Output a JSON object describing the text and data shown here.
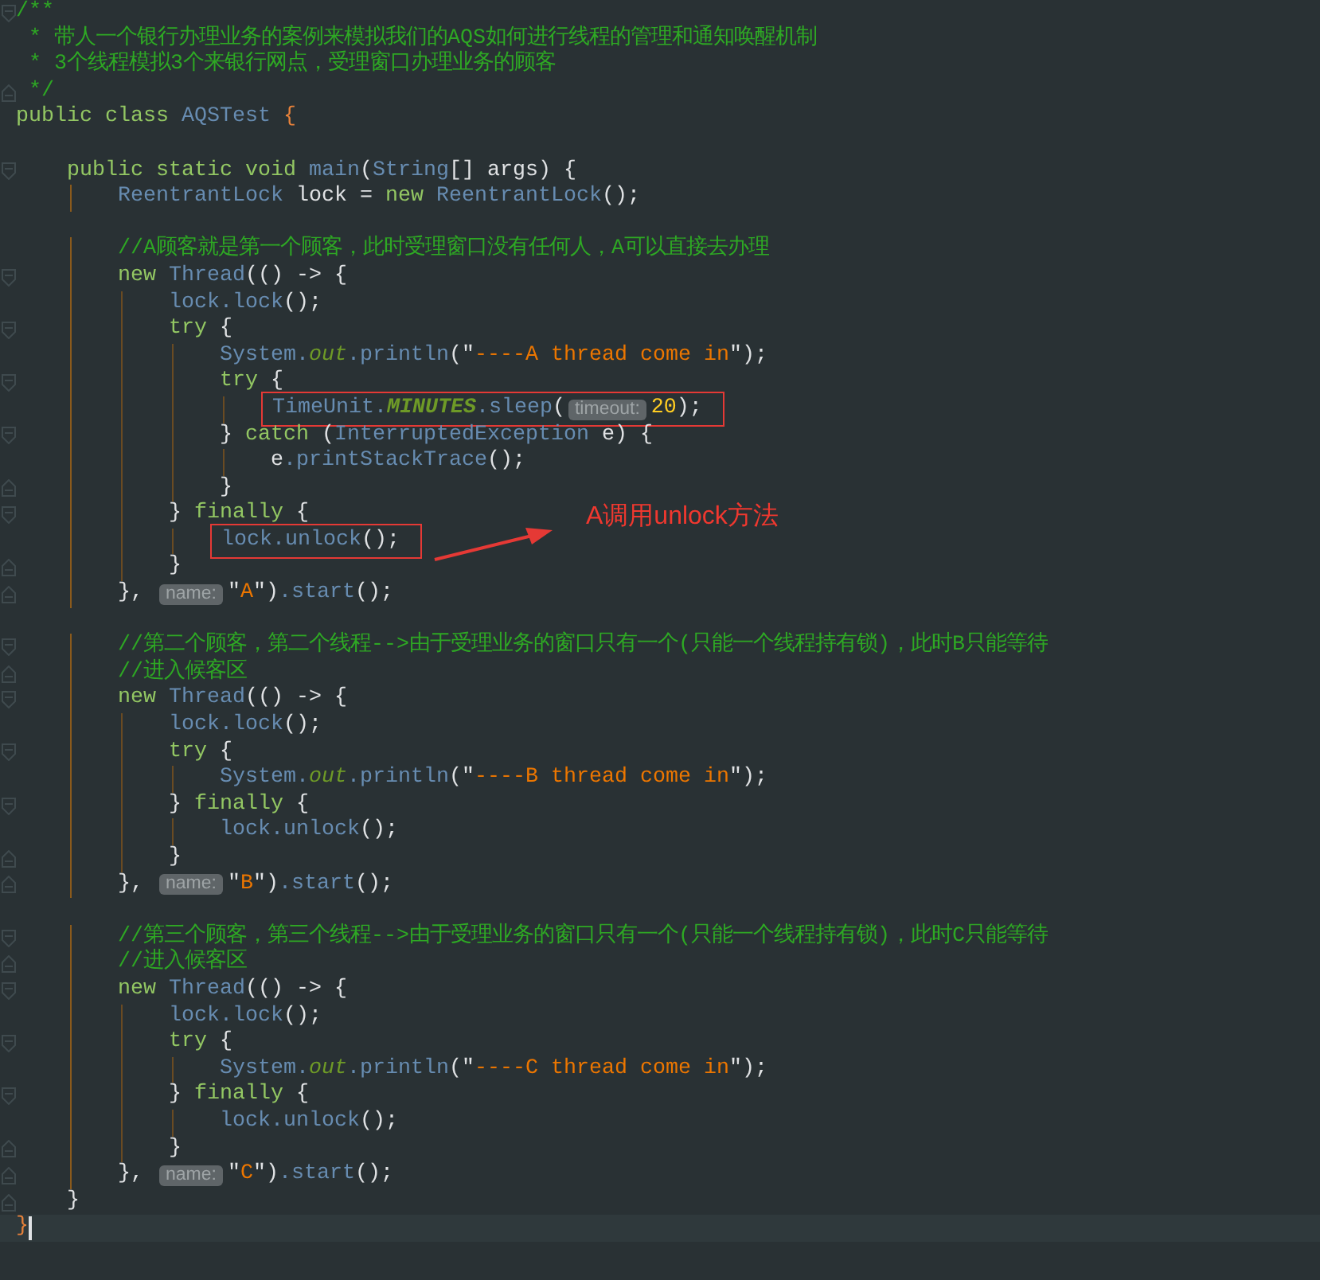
{
  "editor": {
    "lines": [
      {
        "fold_open": true,
        "tokens": [
          {
            "kind": "comment",
            "text": "/**"
          }
        ]
      },
      {
        "tokens": [
          {
            "kind": "comment",
            "text": " * 带人一个银行办理业务的案例来模拟我们的AQS如何进行线程的管理和通知唤醒机制"
          }
        ]
      },
      {
        "tokens": [
          {
            "kind": "comment",
            "text": " * 3个线程模拟3个来银行网点，受理窗口办理业务的顾客"
          }
        ]
      },
      {
        "fold_close": true,
        "tokens": [
          {
            "kind": "comment",
            "text": " */"
          }
        ]
      },
      {
        "tokens": [
          {
            "kind": "keyword",
            "text": "public class "
          },
          {
            "kind": "ident",
            "text": "AQSTest"
          },
          {
            "kind": "accent",
            "text": " {"
          }
        ]
      },
      {
        "blank_before": true,
        "fold_open": true,
        "tokens": [
          {
            "kind": "keyword",
            "text": "    public static void "
          },
          {
            "kind": "ident",
            "text": "main"
          },
          {
            "kind": "plain",
            "text": "("
          },
          {
            "kind": "ident",
            "text": "String"
          },
          {
            "kind": "plain",
            "text": "[] args) {"
          }
        ]
      },
      {
        "tokens": [
          {
            "kind": "ident",
            "text": "        ReentrantLock"
          },
          {
            "kind": "plain",
            "text": " lock = "
          },
          {
            "kind": "keyword",
            "text": "new "
          },
          {
            "kind": "ident",
            "text": "ReentrantLock"
          },
          {
            "kind": "plain",
            "text": "();"
          }
        ]
      },
      {
        "blank_before": true,
        "tokens": [
          {
            "kind": "comment",
            "text": "        //A顾客就是第一个顾客，此时受理窗口没有任何人，A可以直接去办理"
          }
        ]
      },
      {
        "fold_open": true,
        "tokens": [
          {
            "kind": "keyword",
            "text": "        new "
          },
          {
            "kind": "ident",
            "text": "Thread"
          },
          {
            "kind": "plain",
            "text": "(() -> {"
          }
        ]
      },
      {
        "tokens": [
          {
            "kind": "ident",
            "text": "            lock.lock"
          },
          {
            "kind": "plain",
            "text": "();"
          }
        ]
      },
      {
        "fold_open": true,
        "tokens": [
          {
            "kind": "keyword",
            "text": "            try "
          },
          {
            "kind": "plain",
            "text": "{"
          }
        ]
      },
      {
        "tokens": [
          {
            "kind": "ident",
            "text": "                System."
          },
          {
            "kind": "field",
            "text": "out"
          },
          {
            "kind": "ident",
            "text": ".println"
          },
          {
            "kind": "plain",
            "text": "(\""
          },
          {
            "kind": "string",
            "text": "----A thread come in"
          },
          {
            "kind": "plain",
            "text": "\");"
          }
        ]
      },
      {
        "fold_open": true,
        "tokens": [
          {
            "kind": "keyword",
            "text": "                try "
          },
          {
            "kind": "plain",
            "text": "{"
          }
        ]
      },
      {
        "tokens": [
          {
            "kind": "box",
            "tokens": [
              {
                "kind": "ident",
                "text": "                    TimeUnit."
              },
              {
                "kind": "constant",
                "text": "MINUTES"
              },
              {
                "kind": "ident",
                "text": ".sleep"
              },
              {
                "kind": "plain",
                "text": "("
              },
              {
                "kind": "hint",
                "text": "timeout:"
              },
              {
                "kind": "number",
                "text": "20"
              },
              {
                "kind": "plain",
                "text": ");"
              }
            ]
          }
        ]
      },
      {
        "fold_open": true,
        "tokens": [
          {
            "kind": "plain",
            "text": "                } "
          },
          {
            "kind": "keyword",
            "text": "catch "
          },
          {
            "kind": "plain",
            "text": "("
          },
          {
            "kind": "ident",
            "text": "InterruptedException"
          },
          {
            "kind": "plain",
            "text": " e) {"
          }
        ]
      },
      {
        "tokens": [
          {
            "kind": "plain",
            "text": "                    e"
          },
          {
            "kind": "ident",
            "text": ".printStackTrace"
          },
          {
            "kind": "plain",
            "text": "();"
          }
        ]
      },
      {
        "fold_close": true,
        "tokens": [
          {
            "kind": "plain",
            "text": "                }"
          }
        ]
      },
      {
        "fold_open": true,
        "tokens": [
          {
            "kind": "plain",
            "text": "            } "
          },
          {
            "kind": "keyword",
            "text": "finally "
          },
          {
            "kind": "plain",
            "text": "{"
          }
        ]
      },
      {
        "tokens": [
          {
            "kind": "box",
            "tokens": [
              {
                "kind": "ident",
                "text": "                lock.unlock"
              },
              {
                "kind": "plain",
                "text": "();"
              }
            ]
          }
        ]
      },
      {
        "fold_close": true,
        "tokens": [
          {
            "kind": "plain",
            "text": "            }"
          }
        ]
      },
      {
        "fold_close": true,
        "tokens": [
          {
            "kind": "plain",
            "text": "        }, "
          },
          {
            "kind": "hint",
            "text": "name:"
          },
          {
            "kind": "plain",
            "text": "\""
          },
          {
            "kind": "string",
            "text": "A"
          },
          {
            "kind": "plain",
            "text": "\")"
          },
          {
            "kind": "ident",
            "text": ".start"
          },
          {
            "kind": "plain",
            "text": "();"
          }
        ]
      },
      {
        "blank_before": true,
        "fold_open": true,
        "tokens": [
          {
            "kind": "comment",
            "text": "        //第二个顾客，第二个线程-->由于受理业务的窗口只有一个(只能一个线程持有锁)，此时B只能等待"
          }
        ]
      },
      {
        "fold_close": true,
        "tokens": [
          {
            "kind": "comment",
            "text": "        //进入候客区"
          }
        ]
      },
      {
        "fold_open": true,
        "tokens": [
          {
            "kind": "keyword",
            "text": "        new "
          },
          {
            "kind": "ident",
            "text": "Thread"
          },
          {
            "kind": "plain",
            "text": "(() -> {"
          }
        ]
      },
      {
        "tokens": [
          {
            "kind": "ident",
            "text": "            lock.lock"
          },
          {
            "kind": "plain",
            "text": "();"
          }
        ]
      },
      {
        "fold_open": true,
        "tokens": [
          {
            "kind": "keyword",
            "text": "            try "
          },
          {
            "kind": "plain",
            "text": "{"
          }
        ]
      },
      {
        "tokens": [
          {
            "kind": "ident",
            "text": "                System."
          },
          {
            "kind": "field",
            "text": "out"
          },
          {
            "kind": "ident",
            "text": ".println"
          },
          {
            "kind": "plain",
            "text": "(\""
          },
          {
            "kind": "string",
            "text": "----B thread come in"
          },
          {
            "kind": "plain",
            "text": "\");"
          }
        ]
      },
      {
        "fold_open": true,
        "tokens": [
          {
            "kind": "plain",
            "text": "            } "
          },
          {
            "kind": "keyword",
            "text": "finally "
          },
          {
            "kind": "plain",
            "text": "{"
          }
        ]
      },
      {
        "tokens": [
          {
            "kind": "ident",
            "text": "                lock.unlock"
          },
          {
            "kind": "plain",
            "text": "();"
          }
        ]
      },
      {
        "fold_close": true,
        "tokens": [
          {
            "kind": "plain",
            "text": "            }"
          }
        ]
      },
      {
        "fold_close": true,
        "tokens": [
          {
            "kind": "plain",
            "text": "        }, "
          },
          {
            "kind": "hint",
            "text": "name:"
          },
          {
            "kind": "plain",
            "text": "\""
          },
          {
            "kind": "string",
            "text": "B"
          },
          {
            "kind": "plain",
            "text": "\")"
          },
          {
            "kind": "ident",
            "text": ".start"
          },
          {
            "kind": "plain",
            "text": "();"
          }
        ]
      },
      {
        "blank_before": true,
        "fold_open": true,
        "tokens": [
          {
            "kind": "comment",
            "text": "        //第三个顾客，第三个线程-->由于受理业务的窗口只有一个(只能一个线程持有锁)，此时C只能等待"
          }
        ]
      },
      {
        "fold_close": true,
        "tokens": [
          {
            "kind": "comment",
            "text": "        //进入候客区"
          }
        ]
      },
      {
        "fold_open": true,
        "tokens": [
          {
            "kind": "keyword",
            "text": "        new "
          },
          {
            "kind": "ident",
            "text": "Thread"
          },
          {
            "kind": "plain",
            "text": "(() -> {"
          }
        ]
      },
      {
        "tokens": [
          {
            "kind": "ident",
            "text": "            lock.lock"
          },
          {
            "kind": "plain",
            "text": "();"
          }
        ]
      },
      {
        "fold_open": true,
        "tokens": [
          {
            "kind": "keyword",
            "text": "            try "
          },
          {
            "kind": "plain",
            "text": "{"
          }
        ]
      },
      {
        "tokens": [
          {
            "kind": "ident",
            "text": "                System."
          },
          {
            "kind": "field",
            "text": "out"
          },
          {
            "kind": "ident",
            "text": ".println"
          },
          {
            "kind": "plain",
            "text": "(\""
          },
          {
            "kind": "string",
            "text": "----C thread come in"
          },
          {
            "kind": "plain",
            "text": "\");"
          }
        ]
      },
      {
        "fold_open": true,
        "tokens": [
          {
            "kind": "plain",
            "text": "            } "
          },
          {
            "kind": "keyword",
            "text": "finally "
          },
          {
            "kind": "plain",
            "text": "{"
          }
        ]
      },
      {
        "tokens": [
          {
            "kind": "ident",
            "text": "                lock.unlock"
          },
          {
            "kind": "plain",
            "text": "();"
          }
        ]
      },
      {
        "fold_close": true,
        "tokens": [
          {
            "kind": "plain",
            "text": "            }"
          }
        ]
      },
      {
        "fold_close": true,
        "tokens": [
          {
            "kind": "plain",
            "text": "        }, "
          },
          {
            "kind": "hint",
            "text": "name:"
          },
          {
            "kind": "plain",
            "text": "\""
          },
          {
            "kind": "string",
            "text": "C"
          },
          {
            "kind": "plain",
            "text": "\")"
          },
          {
            "kind": "ident",
            "text": ".start"
          },
          {
            "kind": "plain",
            "text": "();"
          }
        ]
      },
      {
        "fold_close": true,
        "tokens": [
          {
            "kind": "plain",
            "text": "    }"
          }
        ]
      },
      {
        "current": true,
        "tokens": [
          {
            "kind": "accent",
            "text": "}"
          }
        ]
      }
    ]
  },
  "annotation": {
    "text": "A调用unlock方法"
  }
}
